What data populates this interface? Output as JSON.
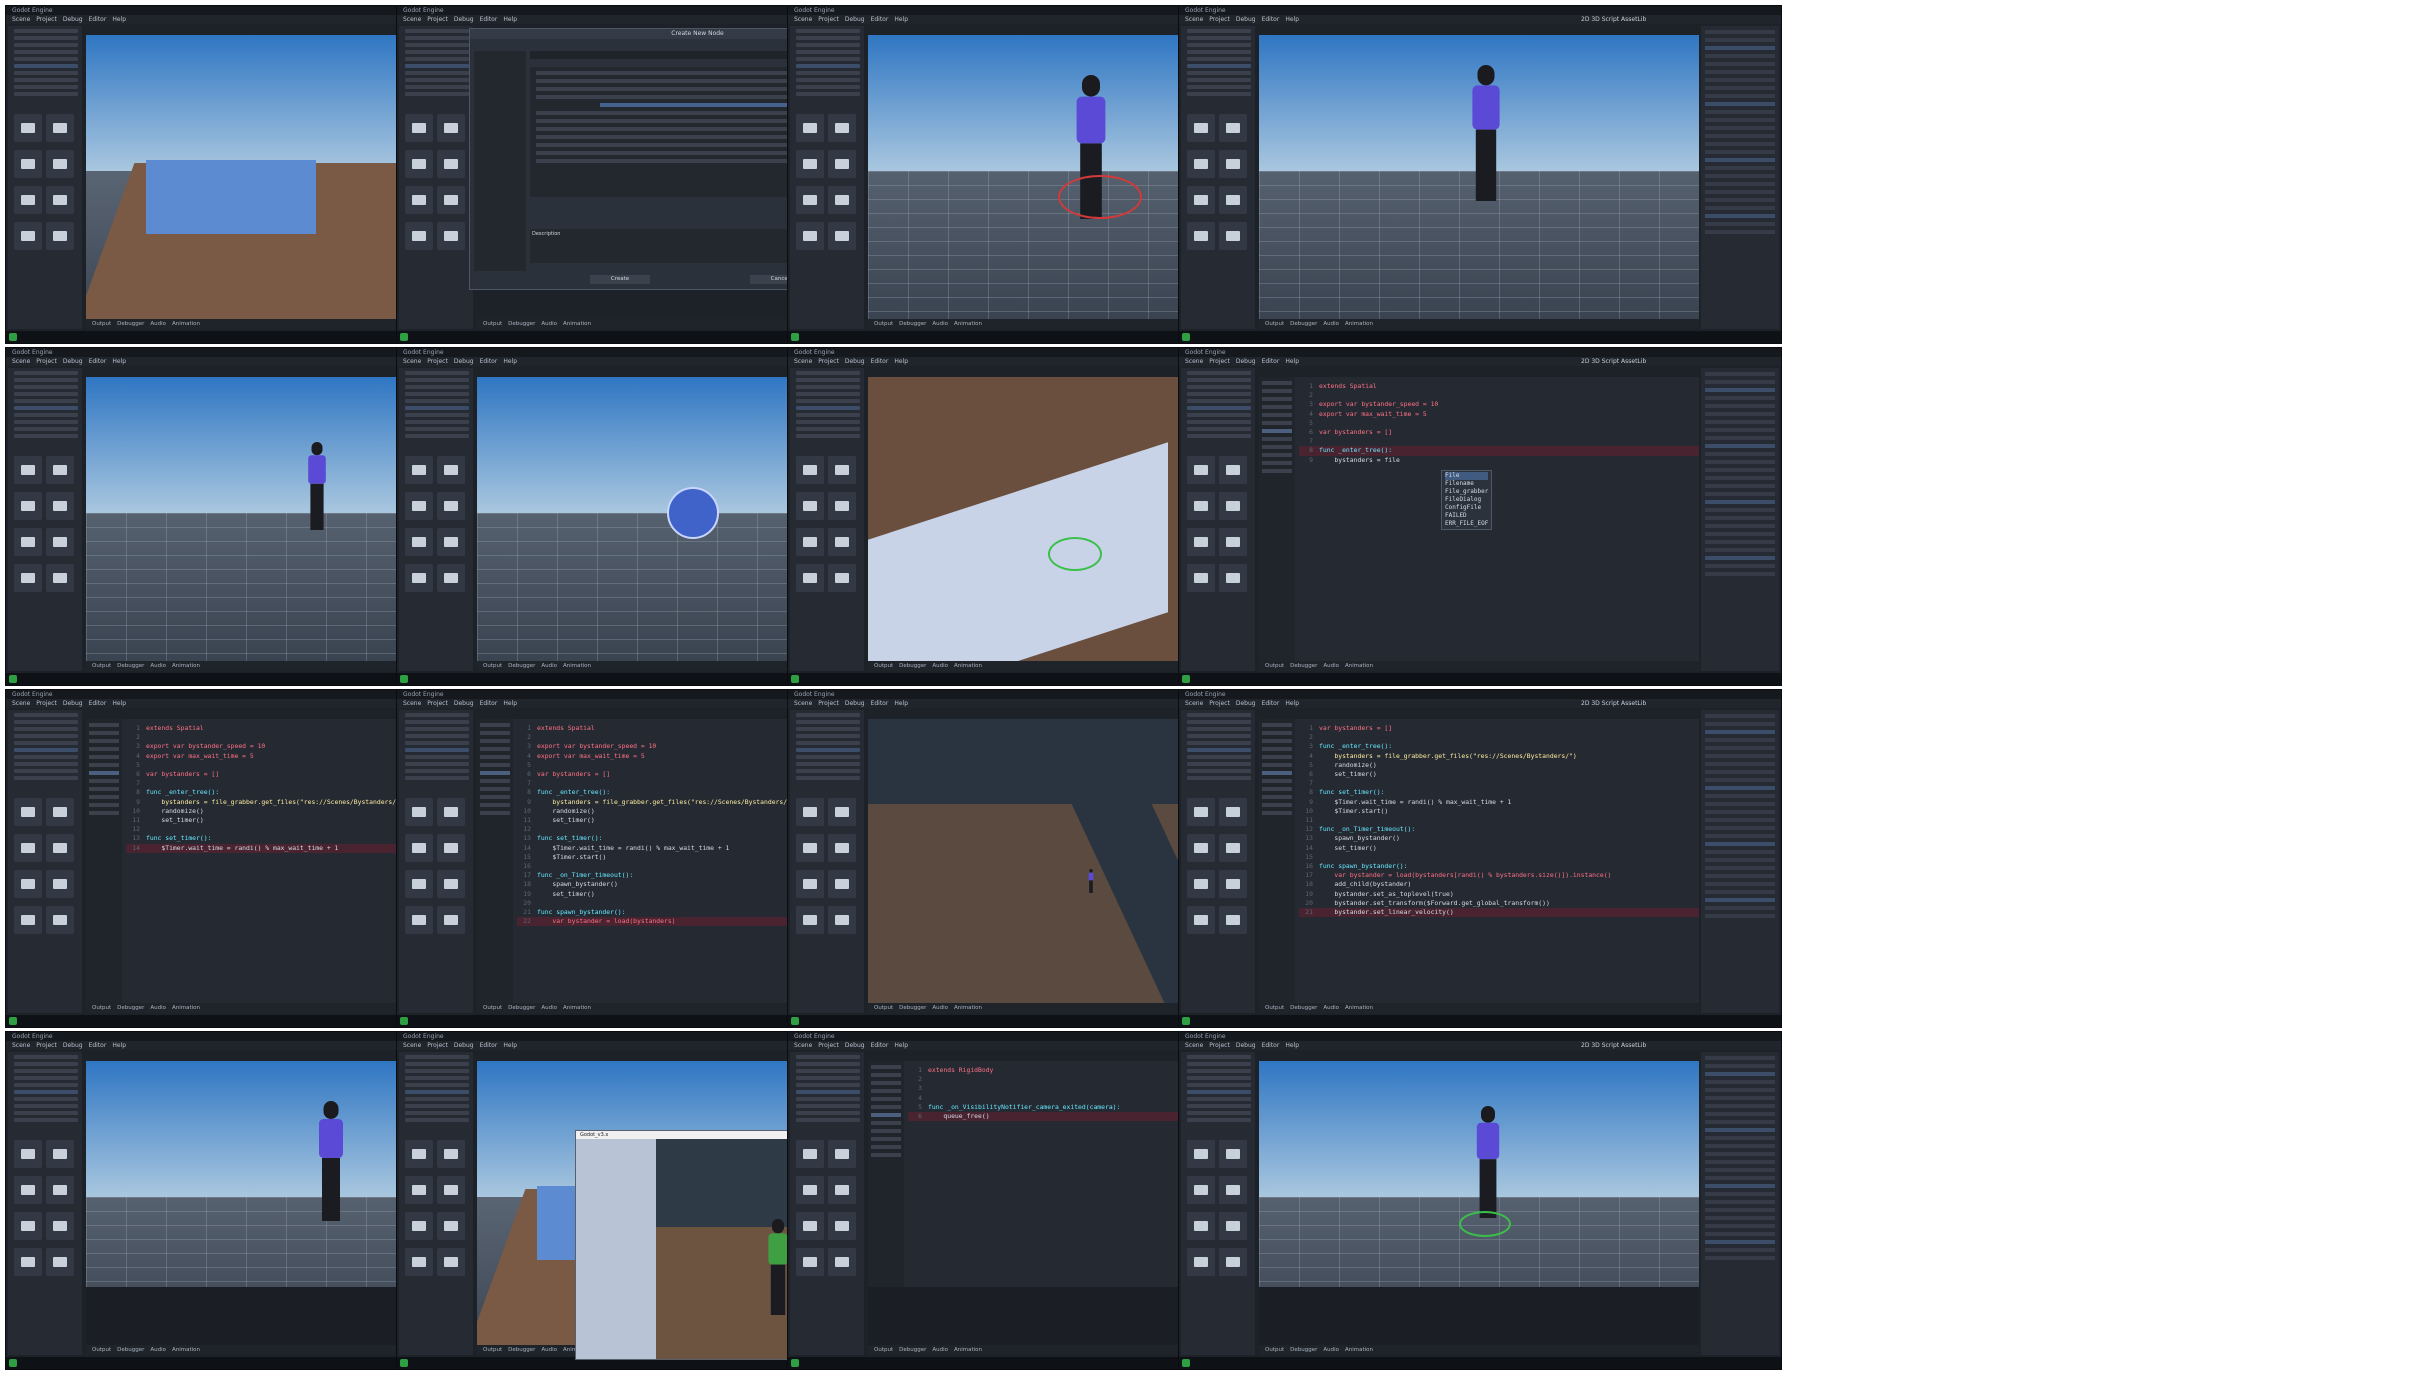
{
  "app": {
    "window_title": "Godot Engine",
    "menus": [
      "Scene",
      "Project",
      "Debug",
      "Editor",
      "Help"
    ],
    "workspace_tabs": [
      "2D",
      "3D",
      "Script",
      "AssetLib"
    ],
    "bottom_tabs": [
      "Output",
      "Debugger",
      "Audio",
      "Animation"
    ],
    "scripts": {
      "spawner_a": [
        "extends Spatial",
        "",
        "export var bystander_speed = 10",
        "export var max_wait_time = 5",
        "",
        "var bystanders = []",
        "",
        "func _enter_tree():",
        "    bystanders = file_grabber.get_files(\"res://Scenes/Bystanders/\")",
        "    randomize()",
        "    set_timer()",
        "",
        "func set_timer():",
        "    $Timer.wait_time = randi() % max_wait_time + 1"
      ],
      "spawner_b": [
        "extends Spatial",
        "",
        "export var bystander_speed = 10",
        "export var max_wait_time = 5",
        "",
        "var bystanders = []",
        "",
        "func _enter_tree():",
        "    bystanders = file_grabber.get_files(\"res://Scenes/Bystanders/\")",
        "    randomize()",
        "    set_timer()",
        "",
        "func set_timer():",
        "    $Timer.wait_time = randi() % max_wait_time + 1",
        "    $Timer.start()",
        "",
        "func _on_Timer_timeout():",
        "    spawn_bystander()",
        "    set_timer()",
        "",
        "func spawn_bystander():",
        "    var bystander = load(bystanders)"
      ],
      "spawner_c": [
        "var bystanders = []",
        "",
        "func _enter_tree():",
        "    bystanders = file_grabber.get_files(\"res://Scenes/Bystanders/\")",
        "    randomize()",
        "    set_timer()",
        "",
        "func set_timer():",
        "    $Timer.wait_time = randi() % max_wait_time + 1",
        "    $Timer.start()",
        "",
        "func _on_Timer_timeout():",
        "    spawn_bystander()",
        "    set_timer()",
        "",
        "func spawn_bystander():",
        "    var bystander = load(bystanders[randi() % bystanders.size()]).instance()",
        "    add_child(bystander)",
        "    bystander.set_as_toplevel(true)",
        "    bystander.set_transform($Forward.get_global_transform())",
        "    bystander.set_linear_velocity()"
      ],
      "autocomplete_script": [
        "extends Spatial",
        "",
        "export var bystander_speed = 10",
        "export var max_wait_time = 5",
        "",
        "var bystanders = []",
        "",
        "func _enter_tree():",
        "    bystanders = file"
      ],
      "autocomplete_options": [
        "File",
        "Filename",
        "File_grabber",
        "FileDialog",
        "ConfigFile",
        "FAILED",
        "ERR_FILE_EOF"
      ],
      "rigidbody_script": [
        "extends RigidBody",
        "",
        "",
        "",
        "func _on_VisibilityNotifier_camera_exited(camera):",
        "    queue_free()"
      ]
    },
    "dialog": {
      "title": "Create New Node",
      "favorites": "Favorites:",
      "search": "Search:",
      "matches": "Matches:",
      "recent": "Recent:",
      "description": "Description",
      "create": "Create",
      "cancel": "Cancel"
    },
    "game_window_title": "Godot_v3.x"
  }
}
